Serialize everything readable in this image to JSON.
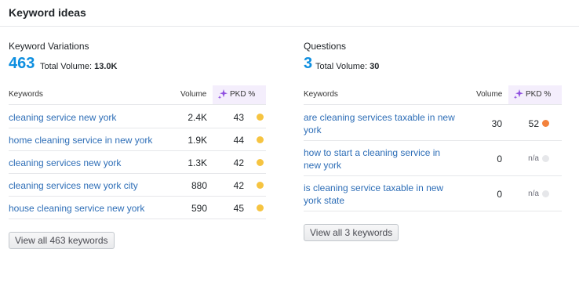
{
  "header": {
    "title": "Keyword ideas"
  },
  "left": {
    "title": "Keyword Variations",
    "count": "463",
    "total_label": "Total Volume:",
    "total_value": "13.0K",
    "col_keywords": "Keywords",
    "col_volume": "Volume",
    "col_pkd": "PKD %",
    "rows": [
      {
        "keyword": "cleaning service new york",
        "volume": "2.4K",
        "pkd": "43",
        "color": "#f6c441"
      },
      {
        "keyword": "home cleaning service in new york",
        "volume": "1.9K",
        "pkd": "44",
        "color": "#f6c441"
      },
      {
        "keyword": "cleaning services new york",
        "volume": "1.3K",
        "pkd": "42",
        "color": "#f6c441"
      },
      {
        "keyword": "cleaning services new york city",
        "volume": "880",
        "pkd": "42",
        "color": "#f6c441"
      },
      {
        "keyword": "house cleaning service new york",
        "volume": "590",
        "pkd": "45",
        "color": "#f6c441"
      }
    ],
    "button": "View all 463 keywords"
  },
  "right": {
    "title": "Questions",
    "count": "3",
    "total_label": "Total Volume:",
    "total_value": "30",
    "col_keywords": "Keywords",
    "col_volume": "Volume",
    "col_pkd": "PKD %",
    "rows": [
      {
        "keyword_line1": "are cleaning services taxable in new",
        "keyword_line2": "york",
        "volume": "30",
        "pkd": "52",
        "color": "#f3823c"
      },
      {
        "keyword_line1": "how to start a cleaning service in",
        "keyword_line2": "new york",
        "volume": "0",
        "pkd": "n/a",
        "color": "#e6e7ea"
      },
      {
        "keyword_line1": "is cleaning service taxable in new",
        "keyword_line2": "york state",
        "volume": "0",
        "pkd": "n/a",
        "color": "#e6e7ea"
      }
    ],
    "button": "View all 3 keywords"
  },
  "icons": {
    "pkd": "sparkle-icon"
  }
}
